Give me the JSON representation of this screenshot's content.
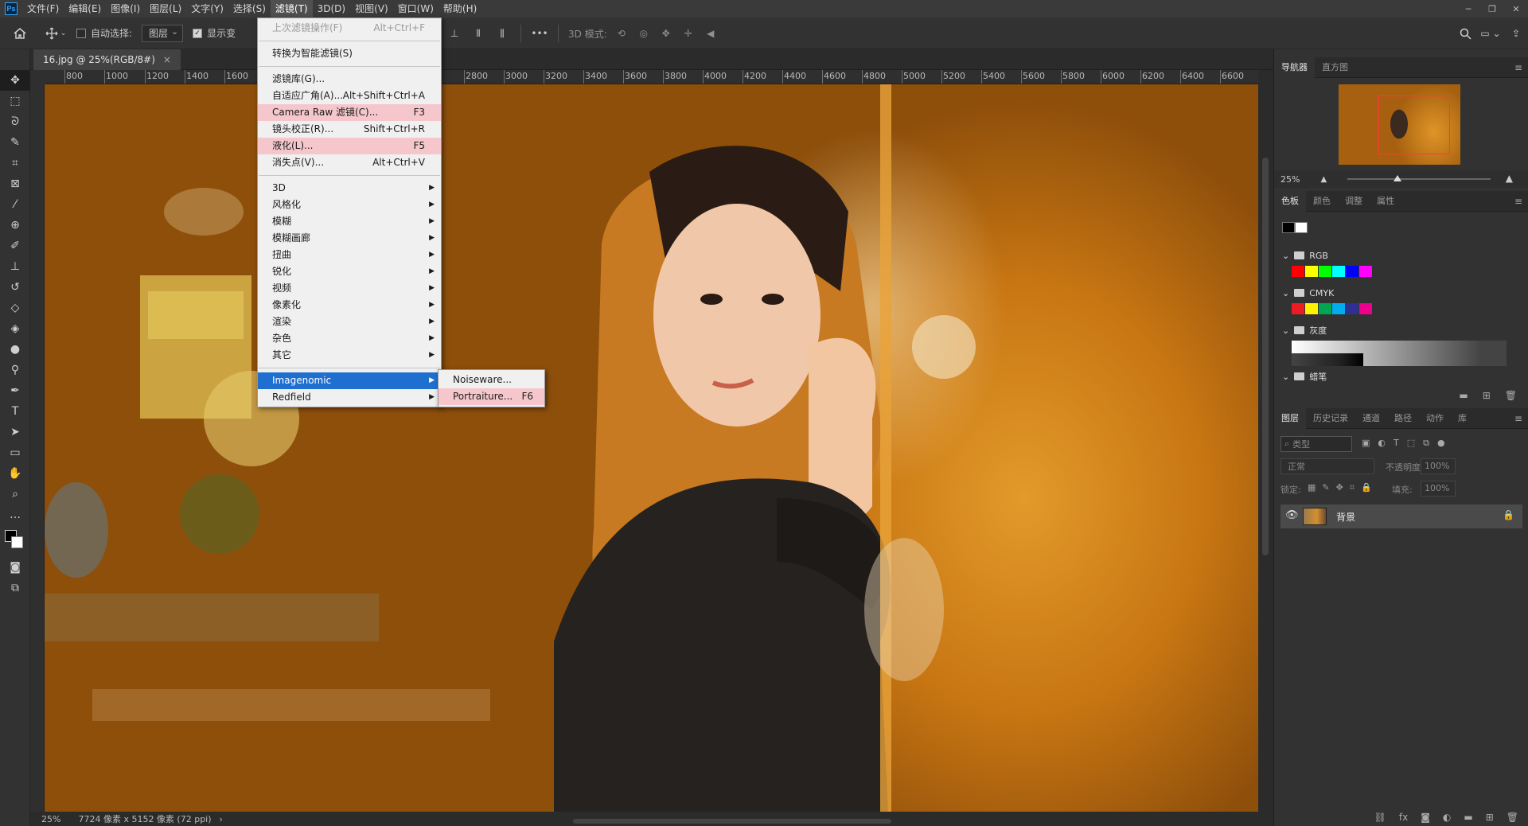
{
  "menubar": {
    "logo": "Ps",
    "items": [
      "文件(F)",
      "编辑(E)",
      "图像(I)",
      "图层(L)",
      "文字(Y)",
      "选择(S)",
      "滤镜(T)",
      "3D(D)",
      "视图(V)",
      "窗口(W)",
      "帮助(H)"
    ],
    "active_index": 6
  },
  "options": {
    "auto_select_label": "自动选择:",
    "auto_select_value": "图层",
    "show_transform_label": "显示变",
    "mode_3d_label": "3D 模式:"
  },
  "document": {
    "tab_title": "16.jpg @ 25%(RGB/8#)",
    "close": "×"
  },
  "ruler": {
    "h_labels": [
      "800",
      "1000",
      "1200",
      "1400",
      "1600",
      "2800",
      "3000",
      "3200",
      "3400",
      "3600",
      "3800",
      "4000",
      "4200",
      "4400",
      "4600",
      "4800",
      "5000",
      "5200",
      "5400",
      "5600",
      "5800",
      "6000",
      "6200",
      "6400",
      "6600"
    ]
  },
  "status": {
    "zoom": "25%",
    "doc_info": "7724 像素 x 5152 像素 (72 ppi)",
    "arrow": "›"
  },
  "filter_menu": {
    "items": [
      {
        "label": "上次滤镜操作(F)",
        "shortcut": "Alt+Ctrl+F",
        "state": "disabled"
      },
      {
        "divider": true
      },
      {
        "label": "转换为智能滤镜(S)",
        "shortcut": "",
        "state": ""
      },
      {
        "divider": true
      },
      {
        "label": "滤镜库(G)...",
        "shortcut": "",
        "state": ""
      },
      {
        "label": "自适应广角(A)...",
        "shortcut": "Alt+Shift+Ctrl+A",
        "state": ""
      },
      {
        "label": "Camera Raw 滤镜(C)...",
        "shortcut": "F3",
        "state": "pink"
      },
      {
        "label": "镜头校正(R)...",
        "shortcut": "Shift+Ctrl+R",
        "state": ""
      },
      {
        "label": "液化(L)...",
        "shortcut": "F5",
        "state": "pink"
      },
      {
        "label": "消失点(V)...",
        "shortcut": "Alt+Ctrl+V",
        "state": ""
      },
      {
        "divider": true
      },
      {
        "label": "3D",
        "submenu": true
      },
      {
        "label": "风格化",
        "submenu": true
      },
      {
        "label": "模糊",
        "submenu": true
      },
      {
        "label": "模糊画廊",
        "submenu": true
      },
      {
        "label": "扭曲",
        "submenu": true
      },
      {
        "label": "锐化",
        "submenu": true
      },
      {
        "label": "视频",
        "submenu": true
      },
      {
        "label": "像素化",
        "submenu": true
      },
      {
        "label": "渲染",
        "submenu": true
      },
      {
        "label": "杂色",
        "submenu": true
      },
      {
        "label": "其它",
        "submenu": true
      },
      {
        "divider": true
      },
      {
        "label": "Imagenomic",
        "submenu": true,
        "state": "hover"
      },
      {
        "label": "Redfield",
        "submenu": true
      }
    ]
  },
  "imagenomic_submenu": {
    "items": [
      {
        "label": "Noiseware...",
        "shortcut": "",
        "state": ""
      },
      {
        "label": "Portraiture...",
        "shortcut": "F6",
        "state": "pink"
      }
    ]
  },
  "navigator": {
    "tabs": [
      "导航器",
      "直方图"
    ],
    "zoom": "25%"
  },
  "swatches": {
    "tabs": [
      "色板",
      "颜色",
      "调整",
      "属性"
    ],
    "groups": [
      "RGB",
      "CMYK",
      "灰度",
      "蜡笔"
    ],
    "rgb_colors": [
      "#ff0000",
      "#ffff00",
      "#00ff00",
      "#00ffff",
      "#0000ff",
      "#ff00ff"
    ],
    "cmyk_colors": [
      "#ed1c24",
      "#fff200",
      "#00a651",
      "#00aeef",
      "#2e3192",
      "#ec008c"
    ]
  },
  "layers": {
    "tabs": [
      "图层",
      "历史记录",
      "通道",
      "路径",
      "动作",
      "库"
    ],
    "filter_placeholder": "类型",
    "blend_mode": "正常",
    "opacity_label": "不透明度:",
    "opacity_value": "100%",
    "lock_label": "锁定:",
    "fill_label": "填充:",
    "fill_value": "100%",
    "layer_name": "背景"
  }
}
